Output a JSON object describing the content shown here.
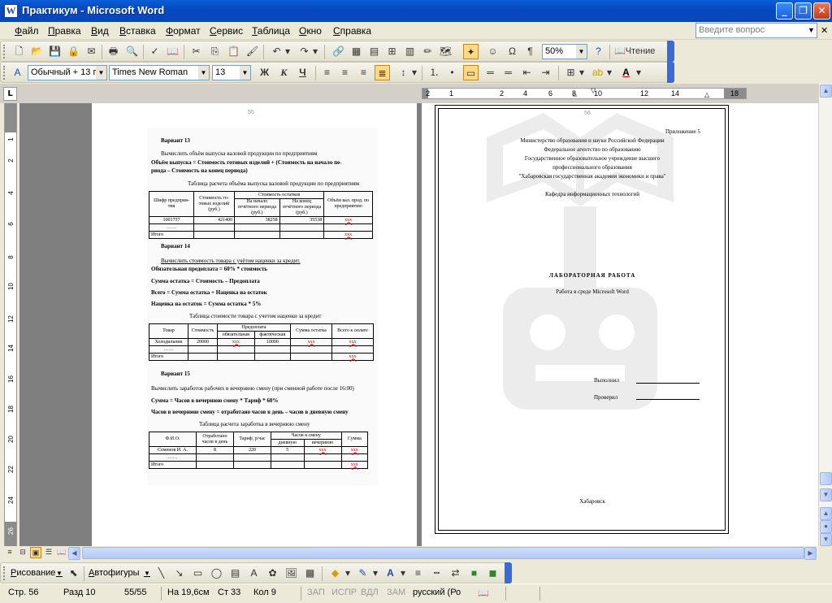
{
  "window": {
    "title": "Практикум - Microsoft Word"
  },
  "menu": [
    "Файл",
    "Правка",
    "Вид",
    "Вставка",
    "Формат",
    "Сервис",
    "Таблица",
    "Окно",
    "Справка"
  ],
  "ask": {
    "placeholder": "Введите вопрос"
  },
  "toolbar1": {
    "zoom": "50%",
    "reading": "Чтение"
  },
  "toolbar2": {
    "style": "Обычный + 13 г",
    "font": "Times New Roman",
    "size": "13",
    "bold": "Ж",
    "italic": "К",
    "underline": "Ч"
  },
  "ruler": {
    "h_labels": [
      "2",
      "1",
      "2",
      "4",
      "6",
      "8",
      "10",
      "12",
      "14",
      "18"
    ],
    "v_labels": [
      "1",
      "2",
      "3",
      "4",
      "5",
      "6",
      "7",
      "8",
      "9",
      "10",
      "11",
      "12",
      "13",
      "14",
      "15",
      "16",
      "17",
      "18",
      "19",
      "20",
      "21",
      "22",
      "23",
      "24",
      "25",
      "26"
    ]
  },
  "page1": {
    "number": "55",
    "v13": {
      "title": "Вариант 13",
      "task": "Вычислить объём выпуска валовой продукции по предприятиям",
      "formula1": "Объём выпуска = Стоимость готовых изделий + (Стоимость на начало пе-",
      "formula2": "риода – Стоимость на конец периода)",
      "caption": "Таблица расчета объёма выпуска валовой продукции по предприятиям",
      "headers": [
        "Шифр предприя-тия",
        "Стоимость го-товых изделий (руб.)",
        "Стоимость остатков",
        "Объём вал. прод. по предприятию"
      ],
      "sub": [
        "На начало отчётного периода (руб.)",
        "На конец отчётного периода (руб.)"
      ],
      "row1": [
        "1001757",
        "421400",
        "38258",
        "35538",
        "ххх"
      ],
      "row2": "……",
      "total": "Итого",
      "total_val": "ххх"
    },
    "v14": {
      "title": "Вариант 14",
      "task": "Вычислить стоимость товара с учётом наценки за кредит.",
      "f1": "Обязательная предоплата = 60% * стоимость",
      "f2": "Сумма остатка = Стоимость – Предоплата",
      "f3": "Всего = Сумма остатка + Наценка на остаток",
      "f4": "Наценка на остаток =   Сумма остатка * 5%",
      "caption": "Таблица стоимости товара с учетом наценки за кредит",
      "headers": [
        "Товар",
        "Стоимость",
        "Предоплата",
        "Сумма остатка",
        "Всего к оплате"
      ],
      "sub": [
        "обязательная",
        "фактическая"
      ],
      "row1": [
        "Холодильник",
        "20000",
        "ххх",
        "10000",
        "ххх",
        "ххх"
      ],
      "row2": "……",
      "total": "Итого",
      "total_val": "ххх"
    },
    "v15": {
      "title": "Вариант 15",
      "task": "Вычислить заработок рабочих в вечернюю смену (при сменной работе после 16:00)",
      "f1": "Сумма = Часов в вечернюю смену * Тариф * 60%",
      "f2": "Часов в вечернюю смену = отработано часов в день – часов в дневную смену",
      "caption": "Таблица расчета  заработка в вечернюю смену",
      "headers": [
        "Ф.И.О.",
        "Отработано часов в день",
        "Тариф, р/час",
        "Часов в смену",
        "Сумма"
      ],
      "sub": [
        "дневную",
        "вечернюю"
      ],
      "row1": [
        "Семенов И. А.",
        "8",
        "220",
        "5",
        "ххх",
        "ххх"
      ],
      "row2": "……",
      "total": "Итого",
      "total_val": "ххх"
    }
  },
  "page2": {
    "number": "56",
    "appendix": "Приложение 5",
    "header": [
      "Министерство образования и науки Российской Федерации",
      "Федеральное агентство по образованию",
      "Государственное образовательное учреждение высшего",
      "профессионального образования",
      "\"Хабаровская государственная академия экономики и права\""
    ],
    "dept": "Кафедра информационных технологий",
    "work": "ЛАБОРАТОРНАЯ   РАБОТА",
    "subject": "Работа в среде Microsoft Word",
    "done": "Выполнил",
    "checked": "Проверил",
    "city": "Хабаровск"
  },
  "drawing": {
    "draw": "Рисование",
    "autoshapes": "Автофигуры"
  },
  "status": {
    "page": "Стр. 56",
    "section": "Разд 10",
    "pages": "55/55",
    "at": "На 19,6см",
    "line": "Ст 33",
    "col": "Кол 9",
    "rec": "ЗАП",
    "trk": "ИСПР",
    "ext": "ВДЛ",
    "ovr": "ЗАМ",
    "lang": "русский (Ро"
  }
}
